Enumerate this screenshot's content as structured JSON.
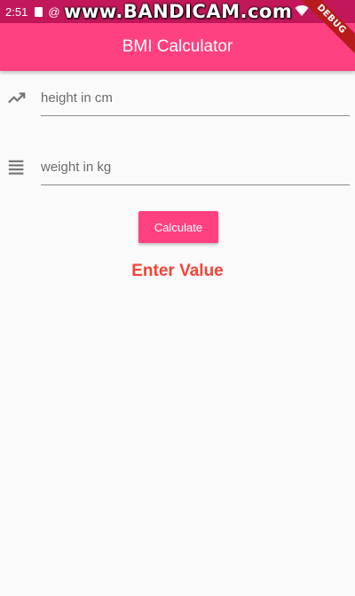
{
  "status_bar": {
    "time": "2:51",
    "watermark": "www.BANDICAM.com",
    "icons": [
      "sd-card-icon",
      "at-icon",
      "wifi-icon",
      "signal-icon"
    ]
  },
  "app_bar": {
    "title": "BMI Calculator",
    "background": "#ff4081",
    "debug_banner": "DEBUG"
  },
  "form": {
    "height_field": {
      "placeholder": "height in cm",
      "value": "",
      "icon": "trending-up-icon"
    },
    "weight_field": {
      "placeholder": "weight in kg",
      "value": "",
      "icon": "list-icon"
    },
    "calculate_label": "Calculate"
  },
  "result": {
    "text": "Enter Value",
    "color": "#f44336"
  }
}
